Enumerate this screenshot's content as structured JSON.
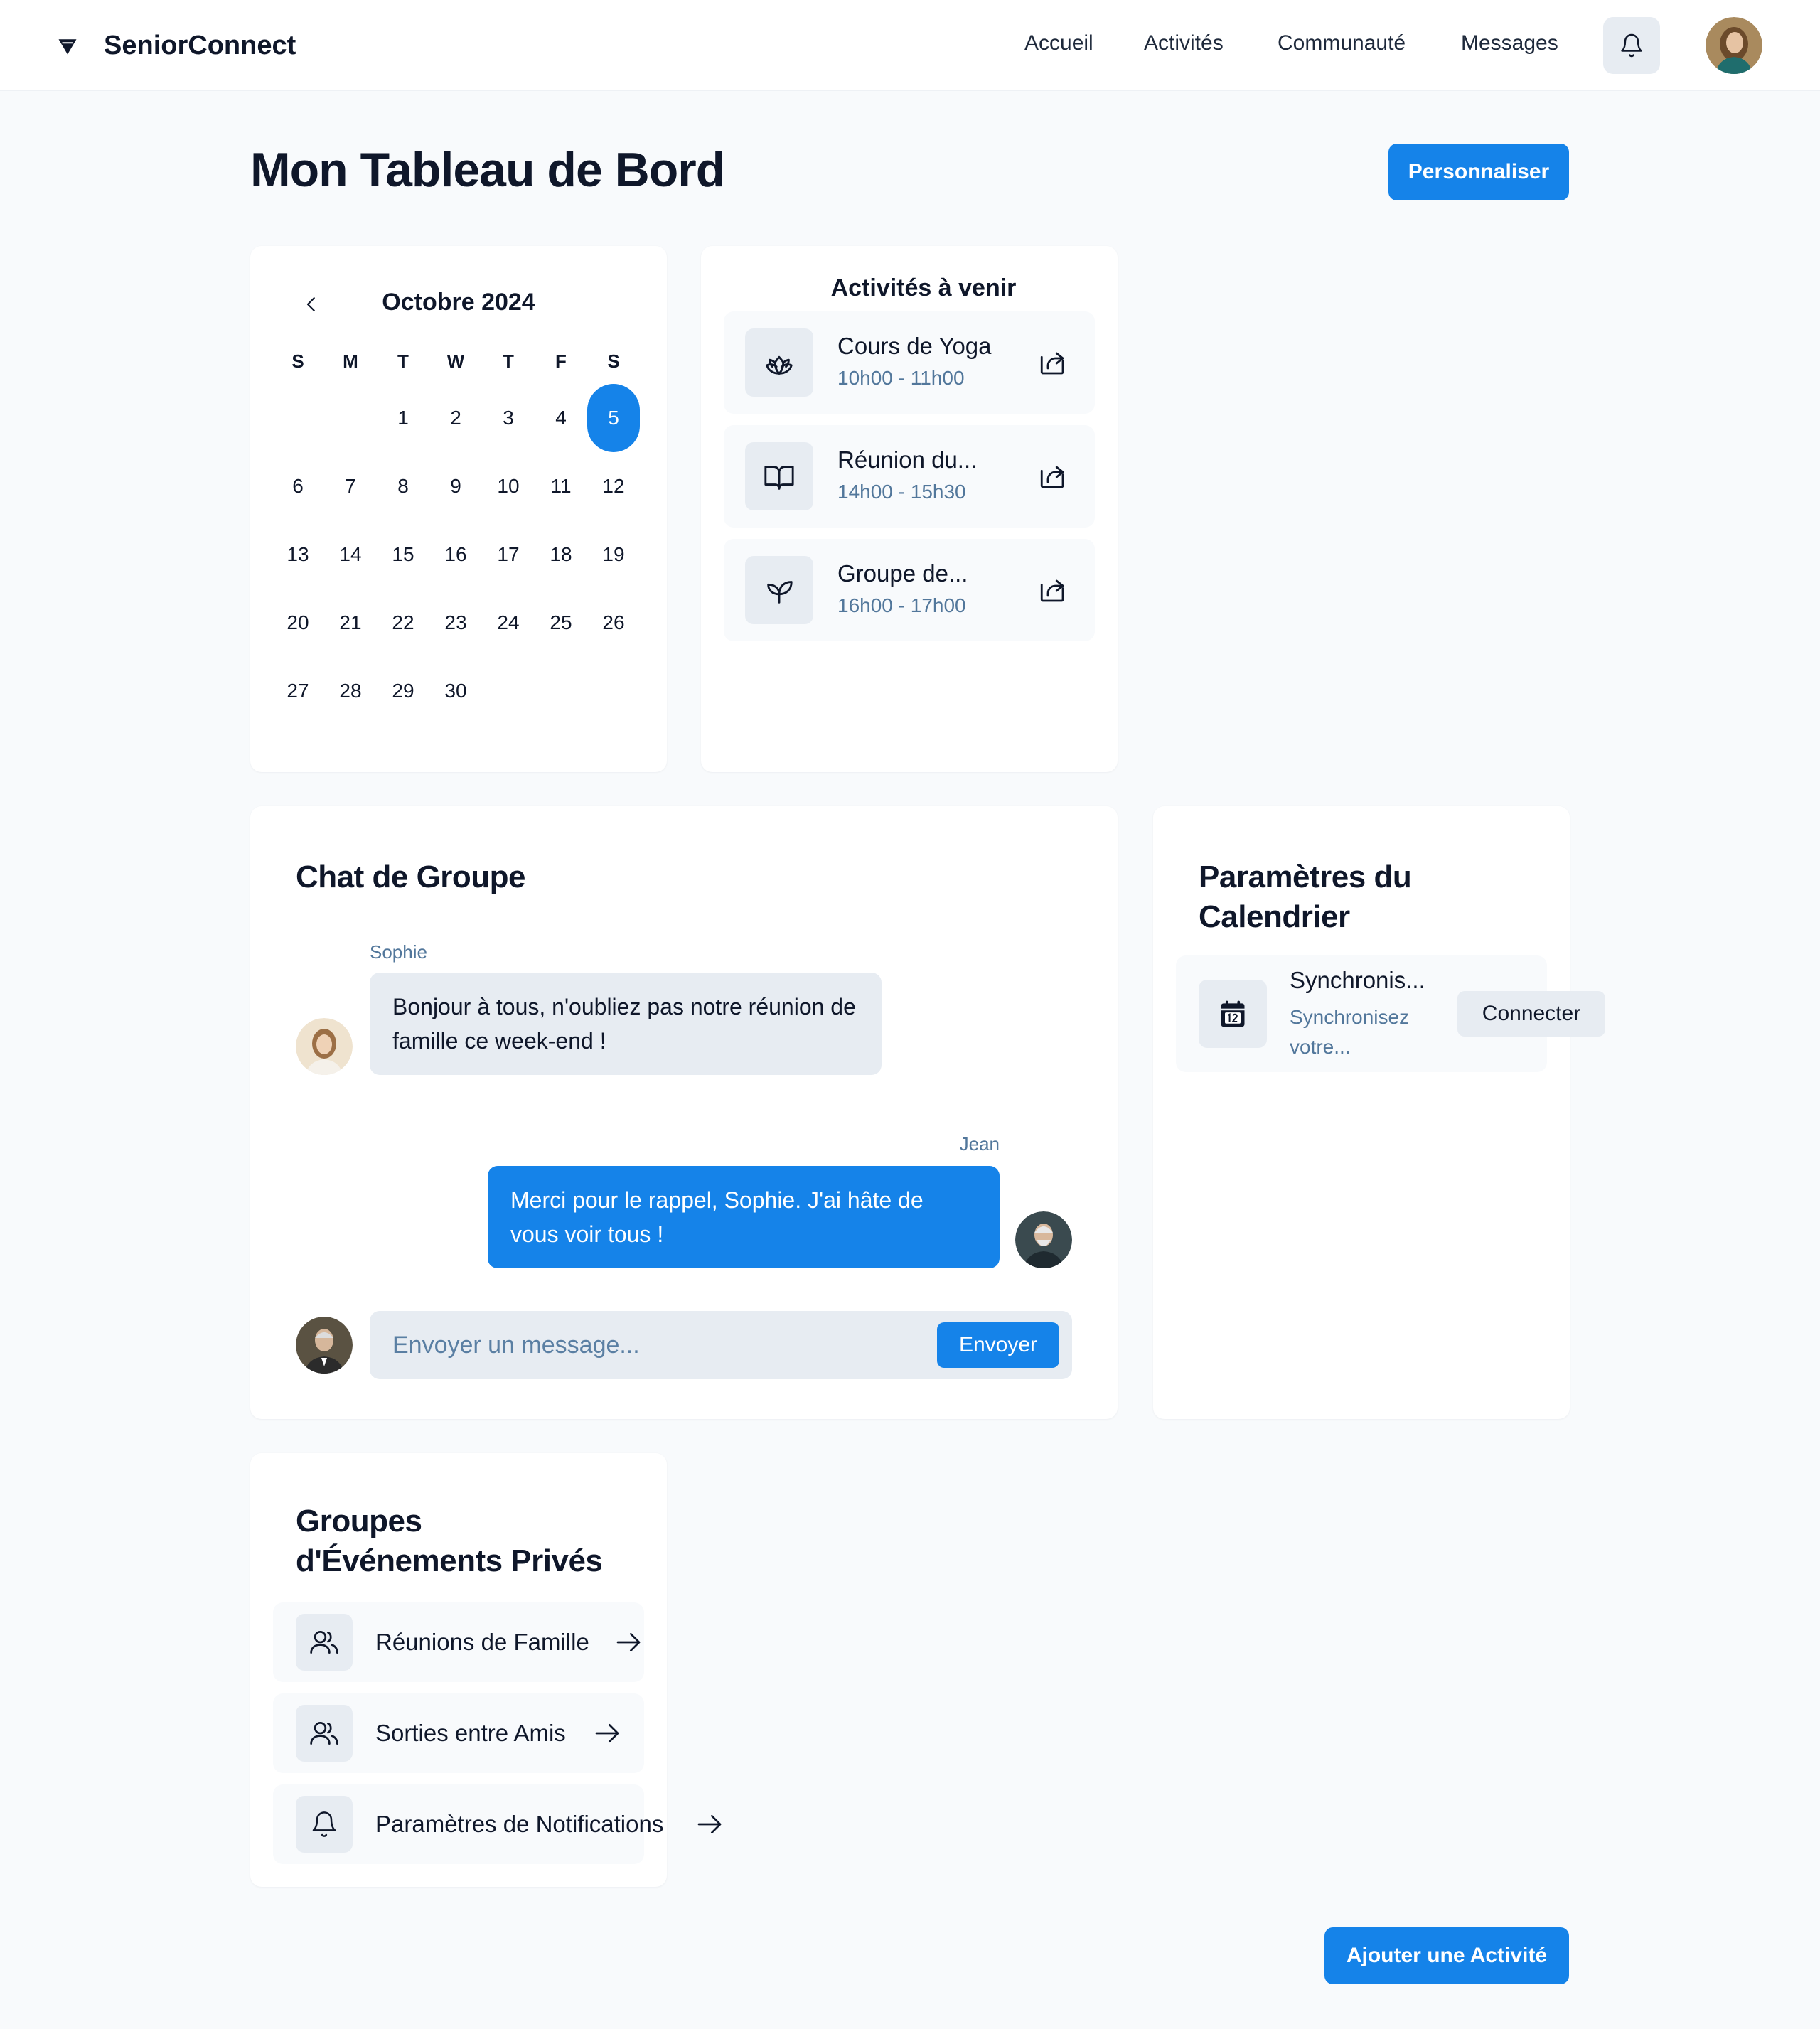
{
  "app": {
    "name": "SeniorConnect"
  },
  "nav": {
    "links": [
      "Accueil",
      "Activités",
      "Communauté",
      "Messages"
    ],
    "bell_icon": "bell-icon",
    "avatar": "user-avatar"
  },
  "header": {
    "title": "Mon Tableau de Bord",
    "customize_label": "Personnaliser"
  },
  "calendar": {
    "month_label": "Octobre 2024",
    "weekdays": [
      "S",
      "M",
      "T",
      "W",
      "T",
      "F",
      "S"
    ],
    "leading_blanks": 2,
    "days_in_month": 30,
    "selected_day": 5
  },
  "activities": {
    "title": "Activités à venir",
    "items": [
      {
        "name": "Cours de Yoga",
        "time": "10h00 - 11h00",
        "icon": "lotus-icon"
      },
      {
        "name": "Réunion du...",
        "time": "14h00 - 15h30",
        "icon": "book-icon"
      },
      {
        "name": "Groupe de...",
        "time": "16h00 - 17h00",
        "icon": "leaf-icon"
      }
    ]
  },
  "chat": {
    "title": "Chat de Groupe",
    "messages": [
      {
        "sender": "Sophie",
        "text": "Bonjour à tous, n'oubliez pas notre réunion de famille ce week-end !"
      },
      {
        "sender": "Jean",
        "text": "Merci pour le rappel, Sophie. J'ai hâte de vous voir tous !"
      }
    ],
    "input_placeholder": "Envoyer un message...",
    "send_label": "Envoyer"
  },
  "settings": {
    "title": "Paramètres du Calendrier",
    "sync_name": "Synchronis...",
    "sync_desc": "Synchronisez votre...",
    "connect_label": "Connecter",
    "icon": "calendar-icon"
  },
  "groups": {
    "title": "Groupes d'Événements Privés",
    "items": [
      {
        "label": "Réunions de Famille",
        "icon": "users-icon"
      },
      {
        "label": "Sorties entre Amis",
        "icon": "users-icon"
      },
      {
        "label": "Paramètres de Notifications",
        "icon": "bell-icon"
      }
    ]
  },
  "footer": {
    "add_label": "Ajouter une Activité"
  },
  "colors": {
    "accent": "#1583e9",
    "muted_text": "#52779b",
    "tile_bg": "#e7ecf2"
  }
}
